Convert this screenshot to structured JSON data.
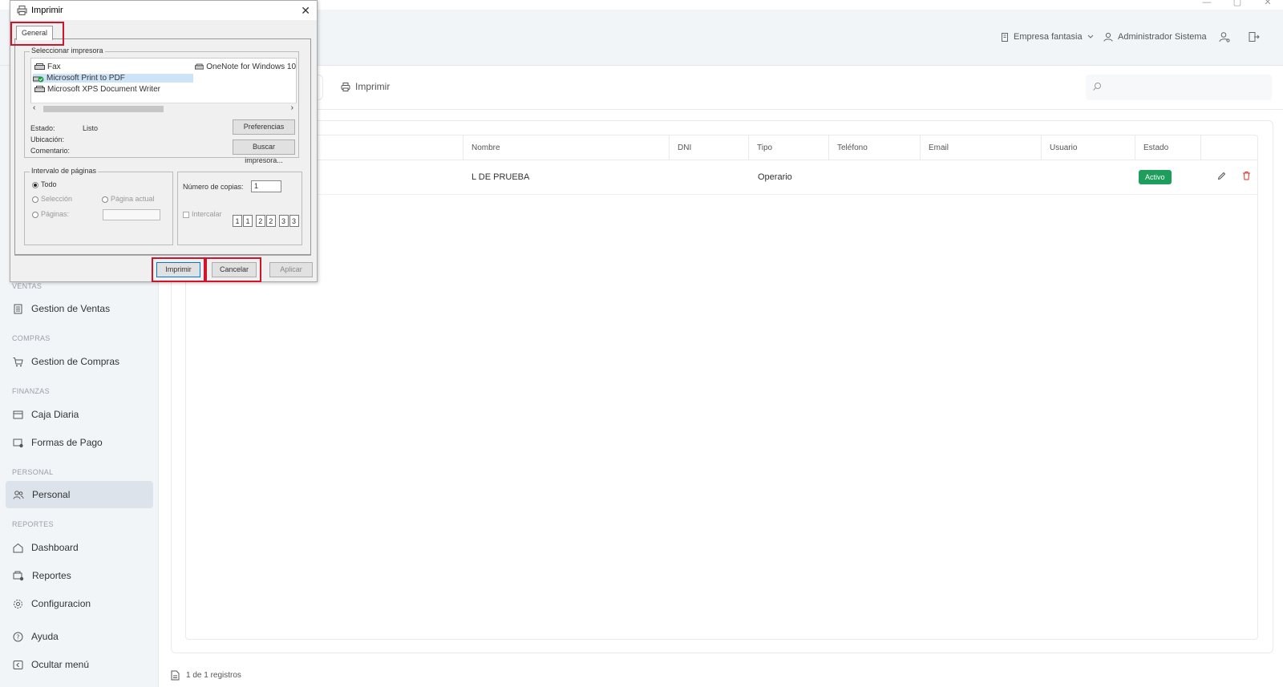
{
  "app": {
    "company": "Empresa fantasia",
    "user": "Administrador Sistema"
  },
  "window_controls": [
    "—",
    "▢",
    "✕"
  ],
  "toolbar": {
    "print_label": "Imprimir",
    "search_placeholder": ""
  },
  "sidebar": {
    "sections": [
      {
        "title": "VENTAS",
        "items": [
          {
            "label": "Gestion de Ventas",
            "icon": "document-list-icon"
          }
        ]
      },
      {
        "title": "COMPRAS",
        "items": [
          {
            "label": "Gestion de Compras",
            "icon": "cart-icon"
          }
        ]
      },
      {
        "title": "FINANZAS",
        "items": [
          {
            "label": "Caja Diaria",
            "icon": "cash-box-icon"
          },
          {
            "label": "Formas de Pago",
            "icon": "payment-methods-icon"
          }
        ]
      },
      {
        "title": "PERSONAL",
        "items": [
          {
            "label": "Personal",
            "icon": "people-icon"
          }
        ]
      },
      {
        "title": "REPORTES",
        "items": [
          {
            "label": "Dashboard",
            "icon": "home-icon"
          },
          {
            "label": "Reportes",
            "icon": "reports-icon"
          },
          {
            "label": "Configuracion",
            "icon": "gear-icon"
          }
        ]
      }
    ],
    "help": "Ayuda",
    "hide_menu": "Ocultar menú"
  },
  "table": {
    "columns": [
      "Nombre",
      "DNI",
      "Tipo",
      "Teléfono",
      "Email",
      "Usuario",
      "Estado"
    ],
    "rows": [
      {
        "nombre": "L DE PRUEBA",
        "dni": "",
        "tipo": "Operario",
        "telefono": "",
        "email": "",
        "usuario": "",
        "estado": "Activo"
      }
    ],
    "status_color": "#1e9e5c",
    "footer": "1 de 1 registros"
  },
  "print_dialog": {
    "title": "Imprimir",
    "tab": "General",
    "select_printer_label": "Seleccionar impresora",
    "printers": [
      {
        "name": "Fax",
        "selected": false
      },
      {
        "name": "Microsoft Print to PDF",
        "selected": true
      },
      {
        "name": "Microsoft XPS Document Writer",
        "selected": false
      },
      {
        "name": "OneNote for Windows 10",
        "selected": false
      }
    ],
    "estado_label": "Estado:",
    "estado_value": "Listo",
    "ubicacion_label": "Ubicación:",
    "comentario_label": "Comentario:",
    "preferences_button": "Preferencias",
    "find_printer_button": "Buscar impresora...",
    "page_range_label": "Intervalo de páginas",
    "range_all": "Todo",
    "range_selection": "Selección",
    "range_current": "Página actual",
    "range_pages": "Páginas:",
    "copies_label": "Número de copias:",
    "copies_value": "1",
    "collate_label": "Intercalar",
    "print_button": "Imprimir",
    "cancel_button": "Cancelar",
    "apply_button": "Aplicar",
    "highlight_color": "#d0142b"
  }
}
